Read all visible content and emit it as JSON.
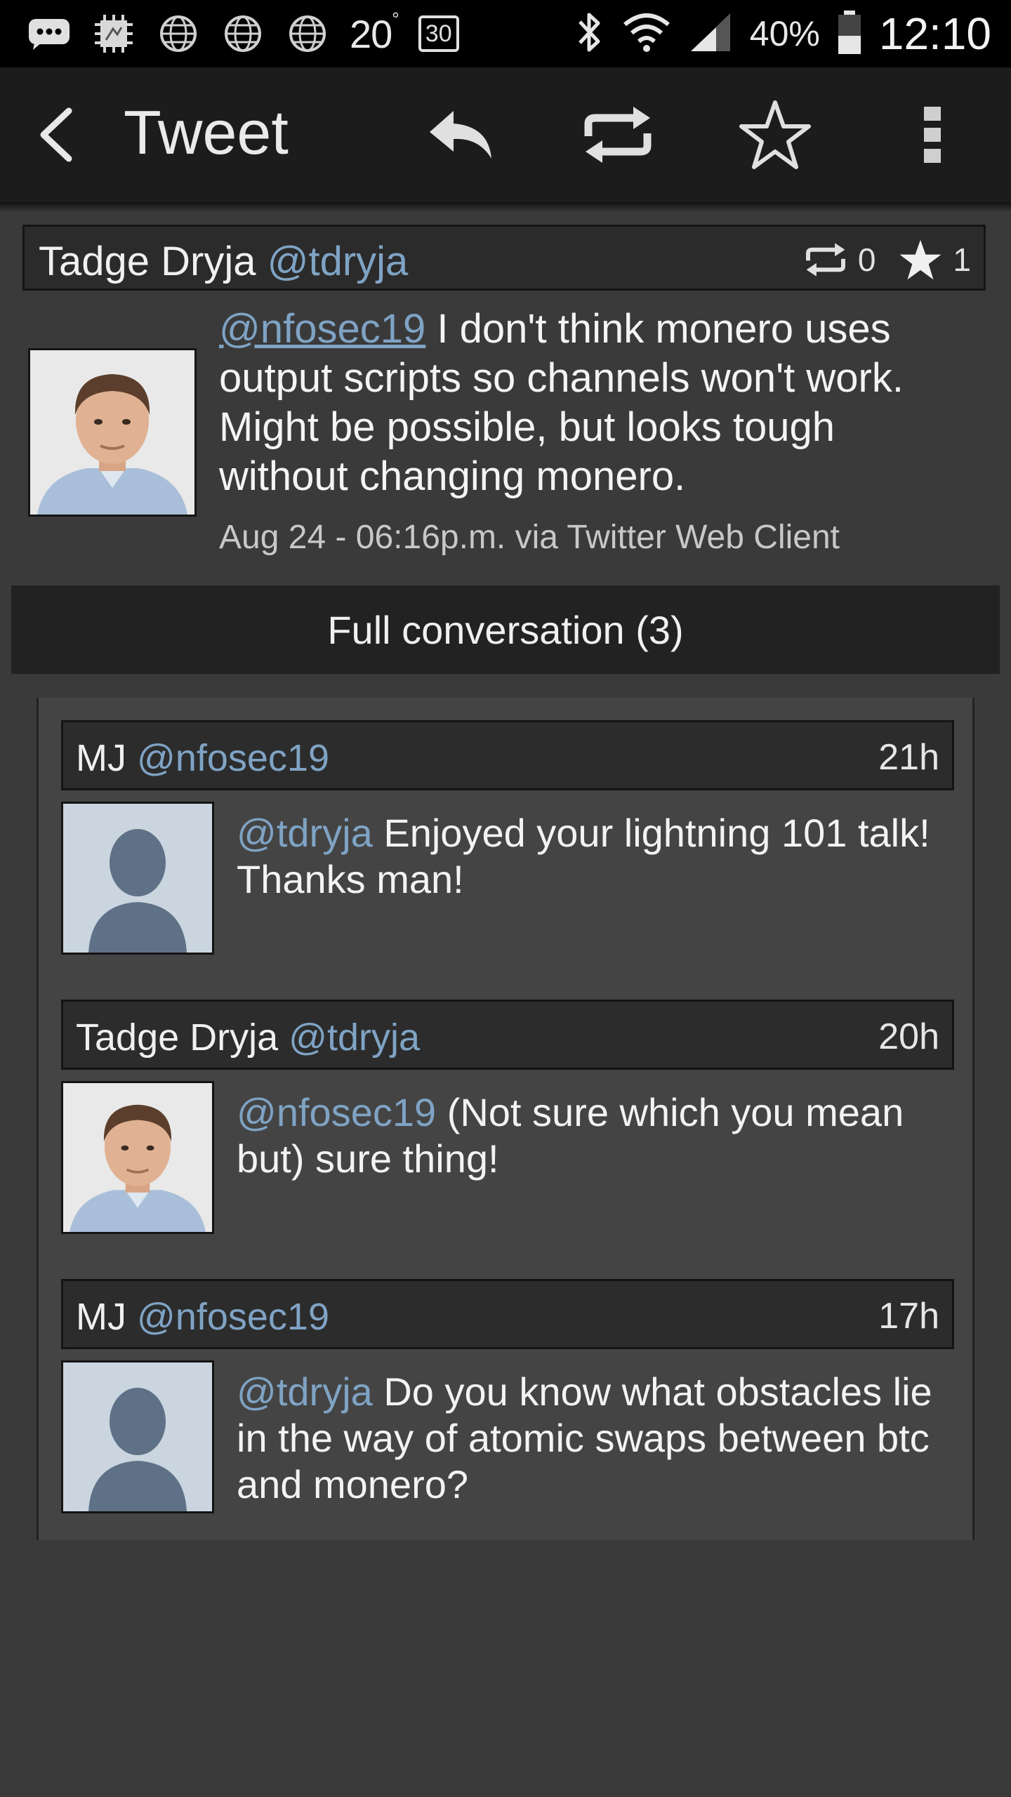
{
  "status_bar": {
    "temperature": "20",
    "temperature_unit": "°",
    "calendar_day": "30",
    "battery_percent": "40%",
    "time": "12:10"
  },
  "action_bar": {
    "title": "Tweet",
    "icons": [
      "back-icon",
      "reply-icon",
      "retweet-icon",
      "favorite-star-icon",
      "overflow-menu-icon"
    ]
  },
  "tweet": {
    "author_name": "Tadge Dryja",
    "author_handle": "@tdryja",
    "retweet_count": "0",
    "favorite_count": "1",
    "mention": "@nfosec19",
    "body": " I don't think monero uses output scripts so channels won't work. Might be possible, but looks tough without changing monero.",
    "meta": "Aug 24 - 06:16p.m. via Twitter Web Client"
  },
  "conversation": {
    "label": "Full conversation (3)",
    "replies": [
      {
        "author_name": "MJ",
        "author_handle": "@nfosec19",
        "time": "21h",
        "mention": "@tdryja",
        "body": " Enjoyed your lightning 101 talk! Thanks man!"
      },
      {
        "author_name": "Tadge Dryja",
        "author_handle": "@tdryja",
        "time": "20h",
        "mention": "@nfosec19",
        "body": " (Not sure which you mean but) sure thing!"
      },
      {
        "author_name": "MJ",
        "author_handle": "@nfosec19",
        "time": "17h",
        "mention": "@tdryja",
        "body": " Do you know what obstacles lie in the way of atomic swaps between btc and monero?"
      }
    ]
  },
  "colors": {
    "handle": "#7fa3c4",
    "background": "#3a3a3a",
    "action_bar": "#1c1c1c"
  }
}
